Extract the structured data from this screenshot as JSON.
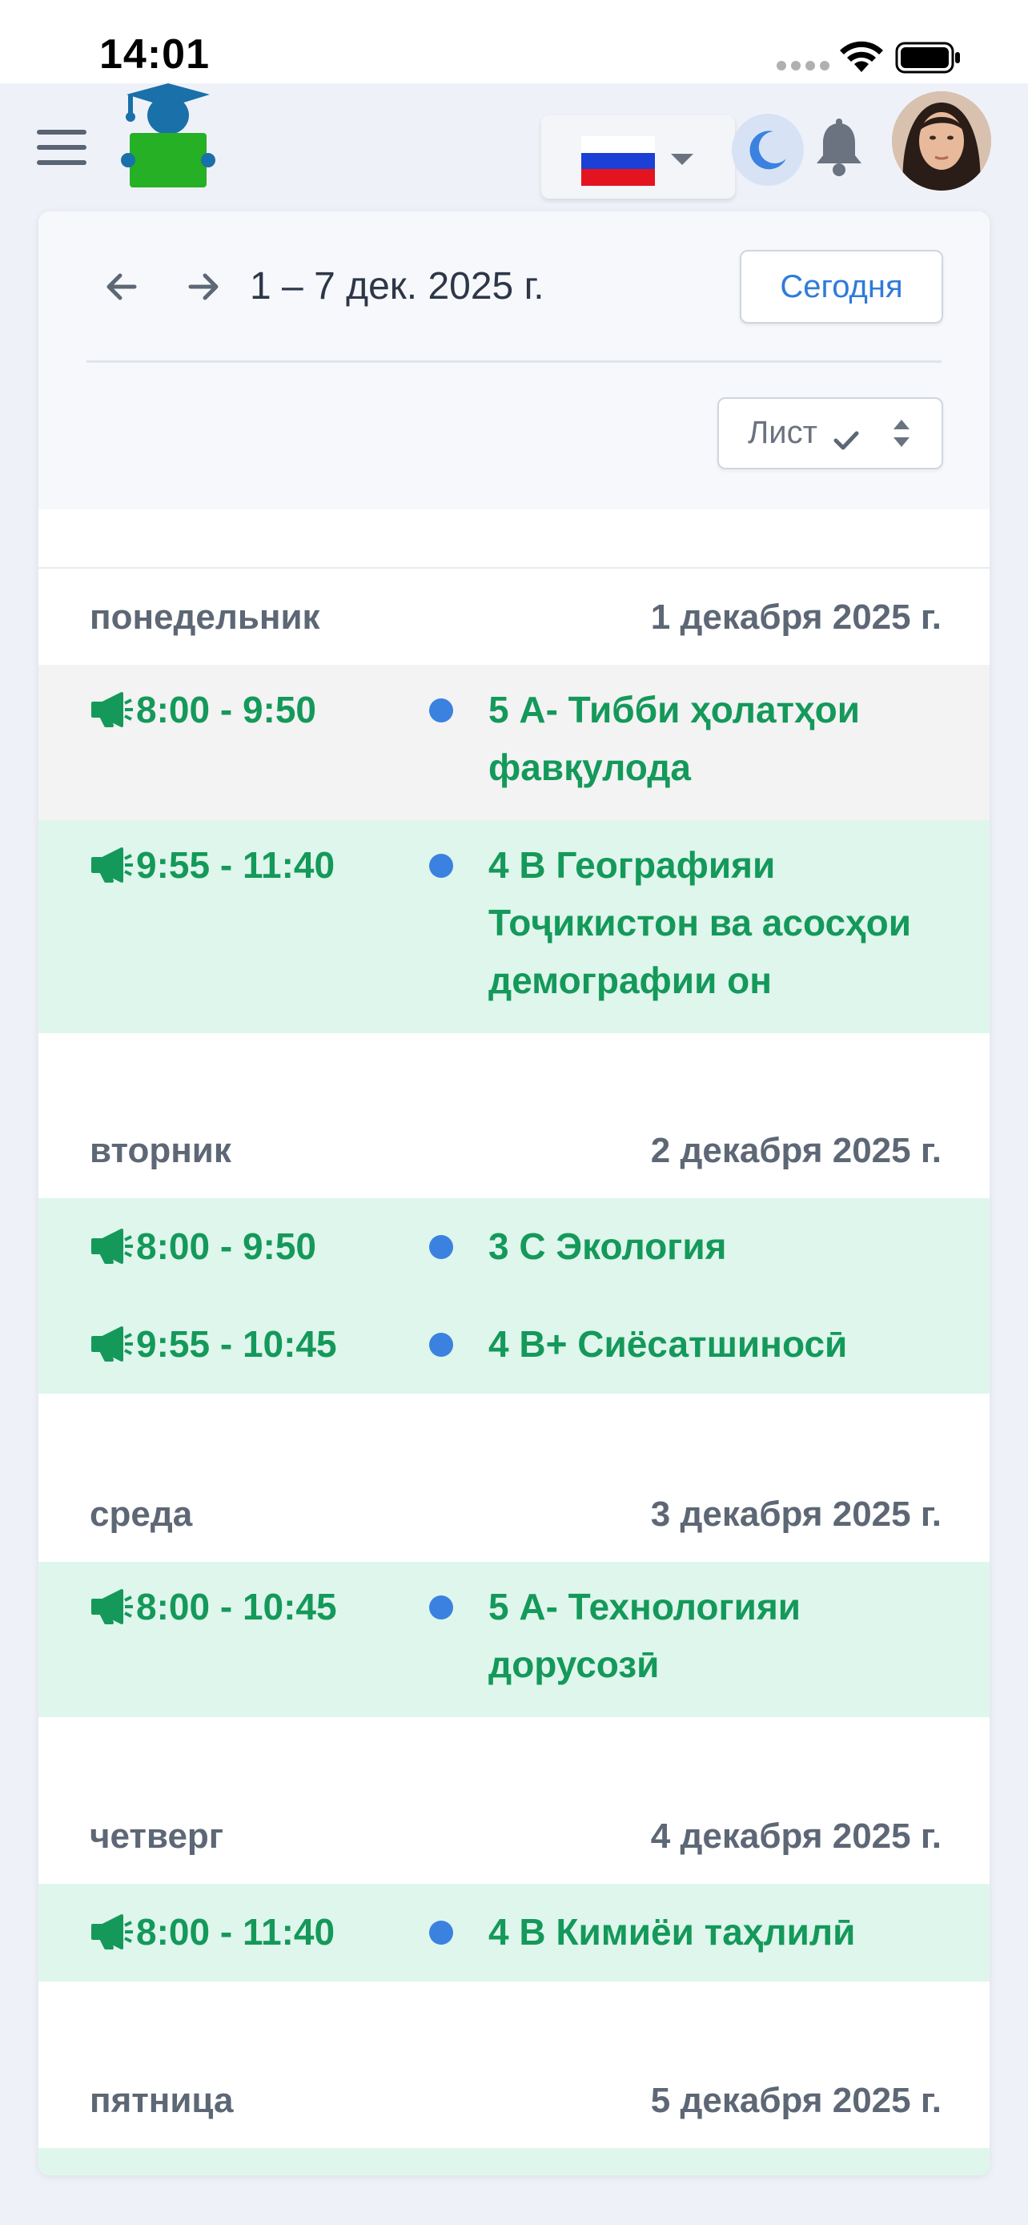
{
  "status_bar": {
    "time": "14:01"
  },
  "header": {
    "language": "ru",
    "icons": [
      "menu-icon",
      "logo",
      "flag-ru",
      "moon-icon",
      "bell-icon",
      "avatar"
    ]
  },
  "toolbar": {
    "date_range": "1 – 7 дек. 2025 г.",
    "today_label": "Сегодня",
    "view_label": "Лист"
  },
  "colors": {
    "accent": "#2f7bd9",
    "event_green": "#14995a",
    "event_bg_green": "#dff6ec",
    "event_bg_gray": "#f3f3f3",
    "dot_blue": "#3b82e0"
  },
  "days": [
    {
      "name": "понедельник",
      "date": "1 декабря 2025 г.",
      "events": [
        {
          "time": "8:00 - 9:50",
          "title": "5 А- Тибби ҳолатҳои фавқулода"
        },
        {
          "time": "9:55 - 11:40",
          "title": "4 В Географияи Тоҷикистон ва асосҳои демографии он"
        }
      ]
    },
    {
      "name": "вторник",
      "date": "2 декабря 2025 г.",
      "events": [
        {
          "time": "8:00 - 9:50",
          "title": "3 С Экология"
        },
        {
          "time": "9:55 - 10:45",
          "title": "4 В+ Сиёсатшиносӣ"
        }
      ]
    },
    {
      "name": "среда",
      "date": "3 декабря 2025 г.",
      "events": [
        {
          "time": "8:00 - 10:45",
          "title": "5 А- Технологияи дорусозӣ"
        }
      ]
    },
    {
      "name": "четверг",
      "date": "4 декабря 2025 г.",
      "events": [
        {
          "time": "8:00 - 11:40",
          "title": "4 В Кимиёи таҳлилӣ"
        }
      ]
    },
    {
      "name": "пятница",
      "date": "5 декабря 2025 г.",
      "events": []
    }
  ]
}
